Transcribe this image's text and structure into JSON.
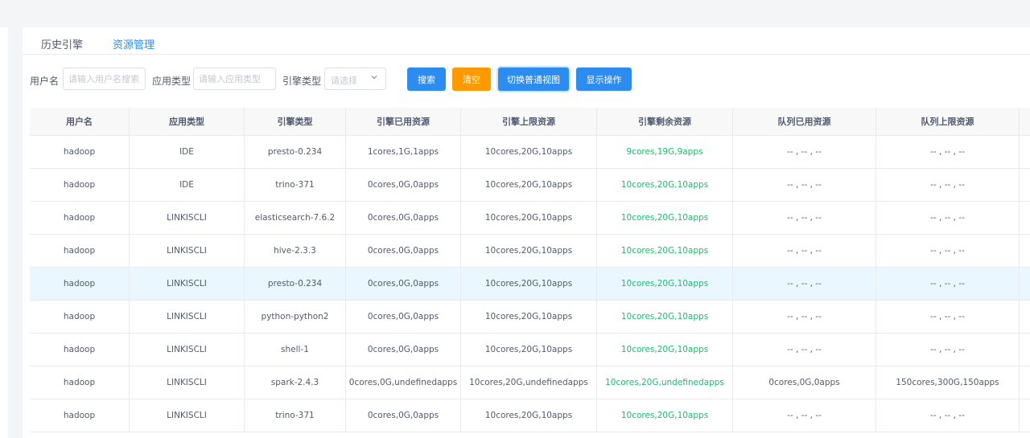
{
  "tabs": [
    {
      "label": "历史引擎",
      "active": false
    },
    {
      "label": "资源管理",
      "active": true
    }
  ],
  "filters": {
    "user_label": "用户名",
    "user_placeholder": "请输入用户名搜索",
    "app_label": "应用类型",
    "app_placeholder": "请输入应用类型",
    "engine_label": "引擎类型",
    "engine_placeholder": "请选择"
  },
  "buttons": {
    "search": "搜索",
    "clear": "清空",
    "switch_view": "切换普通视图",
    "show_ops": "显示操作"
  },
  "colors": {
    "primary": "#2d8cf0",
    "warning": "#ff9900",
    "success": "#19be6b",
    "row_highlight": "#ebf7ff"
  },
  "table": {
    "headers": [
      "用户名",
      "应用类型",
      "引擎类型",
      "引擎已用资源",
      "引擎上限资源",
      "引擎剩余资源",
      "队列已用资源",
      "队列上限资源"
    ],
    "rows": [
      [
        "hadoop",
        "IDE",
        "presto-0.234",
        "1cores,1G,1apps",
        "10cores,20G,10apps",
        "9cores,19G,9apps",
        "-- , -- , --",
        "-- , -- , --"
      ],
      [
        "hadoop",
        "IDE",
        "trino-371",
        "0cores,0G,0apps",
        "10cores,20G,10apps",
        "10cores,20G,10apps",
        "-- , -- , --",
        "-- , -- , --"
      ],
      [
        "hadoop",
        "LINKISCLI",
        "elasticsearch-7.6.2",
        "0cores,0G,0apps",
        "10cores,20G,10apps",
        "10cores,20G,10apps",
        "-- , -- , --",
        "-- , -- , --"
      ],
      [
        "hadoop",
        "LINKISCLI",
        "hive-2.3.3",
        "0cores,0G,0apps",
        "10cores,20G,10apps",
        "10cores,20G,10apps",
        "-- , -- , --",
        "-- , -- , --"
      ],
      [
        "hadoop",
        "LINKISCLI",
        "presto-0.234",
        "0cores,0G,0apps",
        "10cores,20G,10apps",
        "10cores,20G,10apps",
        "-- , -- , --",
        "-- , -- , --"
      ],
      [
        "hadoop",
        "LINKISCLI",
        "python-python2",
        "0cores,0G,0apps",
        "10cores,20G,10apps",
        "10cores,20G,10apps",
        "-- , -- , --",
        "-- , -- , --"
      ],
      [
        "hadoop",
        "LINKISCLI",
        "shell-1",
        "0cores,0G,0apps",
        "10cores,20G,10apps",
        "10cores,20G,10apps",
        "-- , -- , --",
        "-- , -- , --"
      ],
      [
        "hadoop",
        "LINKISCLI",
        "spark-2.4.3",
        "0cores,0G,undefinedapps",
        "10cores,20G,undefinedapps",
        "10cores,20G,undefinedapps",
        "0cores,0G,0apps",
        "150cores,300G,150apps"
      ],
      [
        "hadoop",
        "LINKISCLI",
        "trino-371",
        "0cores,0G,0apps",
        "10cores,20G,10apps",
        "10cores,20G,10apps",
        "-- , -- , --",
        "-- , -- , --"
      ]
    ]
  }
}
